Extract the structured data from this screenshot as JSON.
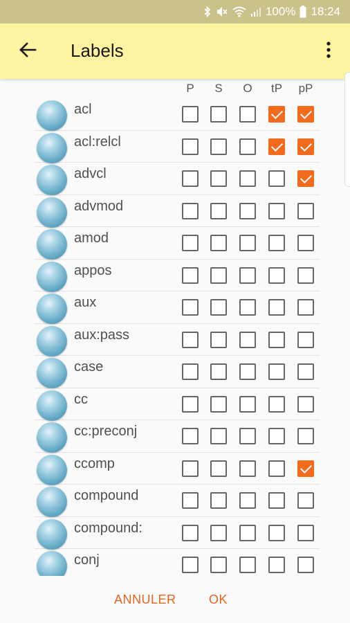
{
  "status_bar": {
    "battery_text": "100%",
    "time": "18:24",
    "icons": [
      "bluetooth-icon",
      "mute-icon",
      "wifi-icon",
      "signal-icon",
      "battery-icon"
    ]
  },
  "app_bar": {
    "title": "Labels",
    "back_icon": "arrow-left-icon",
    "menu_icon": "more-vert-icon",
    "background": "#fdf3a1"
  },
  "columns": [
    "P",
    "S",
    "O",
    "tP",
    "pP"
  ],
  "rows": [
    {
      "label": "acl",
      "checks": [
        false,
        false,
        false,
        true,
        true
      ]
    },
    {
      "label": "acl:relcl",
      "checks": [
        false,
        false,
        false,
        true,
        true
      ]
    },
    {
      "label": "advcl",
      "checks": [
        false,
        false,
        false,
        false,
        true
      ]
    },
    {
      "label": "advmod",
      "checks": [
        false,
        false,
        false,
        false,
        false
      ]
    },
    {
      "label": "amod",
      "checks": [
        false,
        false,
        false,
        false,
        false
      ]
    },
    {
      "label": "appos",
      "checks": [
        false,
        false,
        false,
        false,
        false
      ]
    },
    {
      "label": "aux",
      "checks": [
        false,
        false,
        false,
        false,
        false
      ]
    },
    {
      "label": "aux:pass",
      "checks": [
        false,
        false,
        false,
        false,
        false
      ]
    },
    {
      "label": "case",
      "checks": [
        false,
        false,
        false,
        false,
        false
      ]
    },
    {
      "label": "cc",
      "checks": [
        false,
        false,
        false,
        false,
        false
      ]
    },
    {
      "label": "cc:preconj",
      "checks": [
        false,
        false,
        false,
        false,
        false
      ]
    },
    {
      "label": "ccomp",
      "checks": [
        false,
        false,
        false,
        false,
        true
      ]
    },
    {
      "label": "compound",
      "checks": [
        false,
        false,
        false,
        false,
        false
      ]
    },
    {
      "label": "compound:",
      "checks": [
        false,
        false,
        false,
        false,
        false
      ]
    },
    {
      "label": "conj",
      "checks": [
        false,
        false,
        false,
        false,
        false
      ]
    }
  ],
  "actions": {
    "cancel_label": "ANNULER",
    "ok_label": "OK"
  },
  "colors": {
    "accent": "#f26a1b",
    "action_text": "#e8641a"
  }
}
